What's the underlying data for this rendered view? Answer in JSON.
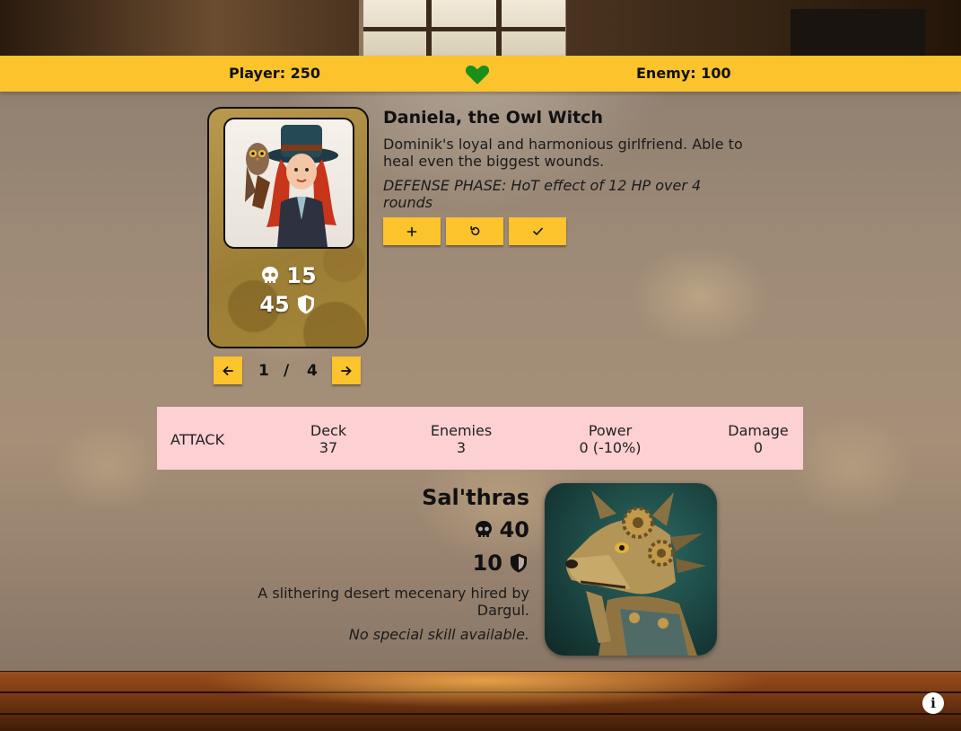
{
  "status_bar": {
    "player_label": "Player: 250",
    "enemy_label": "Enemy: 100",
    "heart_icon": "heart-icon",
    "heart_color": "#1a8f1a"
  },
  "hero": {
    "name": "Daniela, the Owl Witch",
    "description": "Dominik's loyal and harmonious girlfriend. Able to heal even the biggest wounds.",
    "skill": "DEFENSE PHASE: HoT effect of 12 HP over 4 rounds",
    "attack": "15",
    "defense": "45",
    "attack_icon": "skull-icon",
    "defense_icon": "shield-icon",
    "actions": [
      {
        "icon": "plus-icon"
      },
      {
        "icon": "undo-icon"
      },
      {
        "icon": "check-icon"
      }
    ]
  },
  "pager": {
    "current": "1",
    "separator": "/",
    "total": "4",
    "prev_icon": "arrow-left-icon",
    "next_icon": "arrow-right-icon"
  },
  "info_strip": {
    "phase": "ATTACK",
    "columns": [
      {
        "label": "Deck",
        "value": "37"
      },
      {
        "label": "Enemies",
        "value": "3"
      },
      {
        "label": "Power",
        "value": "0 (-10%)"
      },
      {
        "label": "Damage",
        "value": "0"
      }
    ]
  },
  "enemy": {
    "name": "Sal'thras",
    "attack": "40",
    "defense": "10",
    "description": "A slithering desert mecenary hired by Dargul.",
    "skill": "No special skill available."
  },
  "colors": {
    "accent": "#fbc32c",
    "strip": "#fdd0d3"
  }
}
